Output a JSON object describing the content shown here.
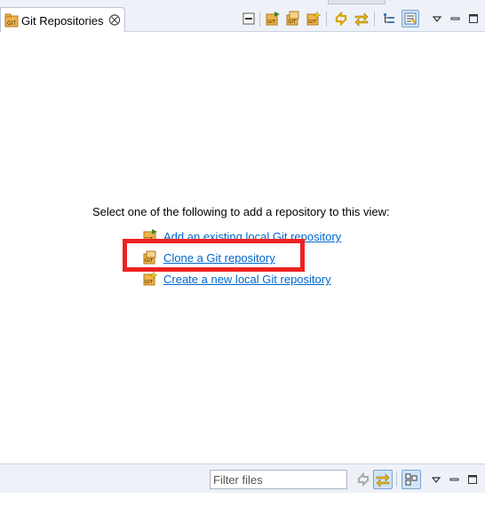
{
  "view": {
    "tab_title": "Git Repositories",
    "tab_close_glyph": "⨂"
  },
  "toolbar": {
    "buttons": [
      {
        "name": "collapse-all-icon"
      },
      {
        "name": "add-existing-repository-icon"
      },
      {
        "name": "clone-repository-icon"
      },
      {
        "name": "create-repository-icon"
      },
      {
        "name": "refresh-icon"
      },
      {
        "name": "link-with-selection-icon"
      },
      {
        "name": "hierarchical-layout-icon"
      },
      {
        "name": "show-details-icon"
      },
      {
        "name": "view-menu-icon"
      },
      {
        "name": "minimize-icon"
      },
      {
        "name": "maximize-icon"
      }
    ]
  },
  "content": {
    "instruction": "Select one of the following to add a repository to this view:",
    "actions": [
      {
        "label": "Add an existing local Git repository",
        "icon": "add-repository-icon"
      },
      {
        "label": "Clone a Git repository",
        "icon": "clone-repository-icon",
        "highlighted": true
      },
      {
        "label": "Create a new local Git repository",
        "icon": "create-repository-icon"
      }
    ],
    "highlight_color": "#ee2222"
  },
  "bottom": {
    "filter_placeholder": "Filter files"
  },
  "colors": {
    "link": "#0066cc",
    "git_icon": "#e8a53a",
    "toolbar_bg": "#eef2f8"
  }
}
